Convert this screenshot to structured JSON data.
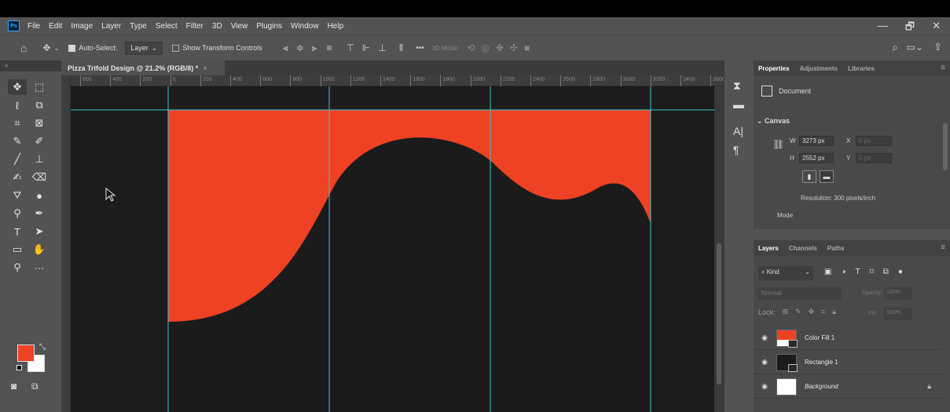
{
  "menubar": {
    "logo": "Ps",
    "items": [
      "File",
      "Edit",
      "Image",
      "Layer",
      "Type",
      "Select",
      "Filter",
      "3D",
      "View",
      "Plugins",
      "Window",
      "Help"
    ],
    "window_controls": [
      "—",
      "🗗",
      "✕"
    ]
  },
  "options": {
    "auto_select_label": "Auto-Select:",
    "auto_select_checked": true,
    "layer_select": "Layer",
    "show_transform_label": "Show Transform Controls",
    "show_transform_checked": false,
    "more": "•••",
    "mode_3d": "3D Mode:"
  },
  "document": {
    "tab_title": "Pizza Trifold Design @ 21.2% (RGB/8) *",
    "close_glyph": "×",
    "ruler_labels": [
      "600",
      "400",
      "200",
      "0",
      "200",
      "400",
      "600",
      "800",
      "1000",
      "1200",
      "1400",
      "1600",
      "1800",
      "2000",
      "2200",
      "2400",
      "2600",
      "2800",
      "3000",
      "3200",
      "3400",
      "3600"
    ],
    "artwork_colors": {
      "fill": "#ef4123",
      "wave": "#1b1b1b",
      "guides": "#3ec6d0"
    }
  },
  "toolbox": {
    "foreground_color": "#ef4123",
    "background_color": "#ffffff"
  },
  "properties": {
    "tabs": [
      "Properties",
      "Adjustments",
      "Libraries"
    ],
    "section": "Document",
    "canvas_header": "Canvas",
    "width_label": "W",
    "width_value": "3273 px",
    "height_label": "H",
    "height_value": "2552 px",
    "x_label": "X",
    "x_value": "0 px",
    "y_label": "Y",
    "y_value": "0 px",
    "resolution": "Resolution: 300 pixels/inch",
    "mode_label": "Mode"
  },
  "layers": {
    "tabs": [
      "Layers",
      "Channels",
      "Paths"
    ],
    "filter_kind": "Kind",
    "blend_mode": "Normal",
    "opacity_label": "Opacity:",
    "opacity_value": "100%",
    "lock_label": "Lock:",
    "fill_label": "Fill:",
    "fill_value": "100%",
    "items": [
      {
        "name": "Color Fill 1",
        "visible": true
      },
      {
        "name": "Rectangle 1",
        "visible": true
      },
      {
        "name": "Background",
        "visible": true,
        "locked": true
      }
    ]
  }
}
